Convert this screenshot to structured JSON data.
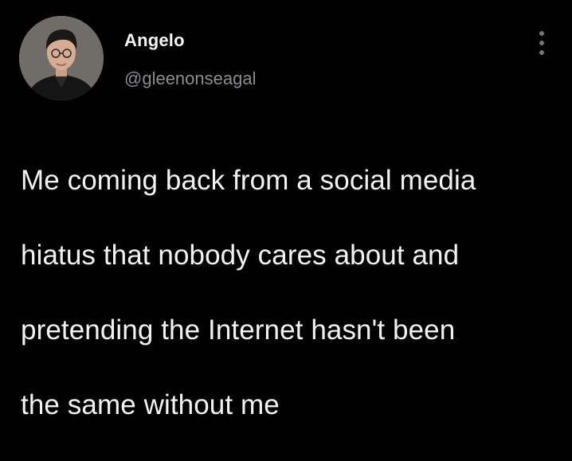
{
  "author": {
    "name": "Angelo",
    "handle": "@gleenonseagal"
  },
  "tweet": {
    "lines": [
      "Me coming back from a social media",
      "hiatus that nobody cares about and",
      "pretending the Internet hasn't been",
      "the same without me"
    ]
  },
  "icons": {
    "more": "more-vertical-icon",
    "avatar": "profile-photo"
  },
  "colors": {
    "background": "#000000",
    "name": "#f5f5f5",
    "handle": "#8a8d91",
    "text": "#f2f2f2",
    "icon": "#71767b"
  }
}
